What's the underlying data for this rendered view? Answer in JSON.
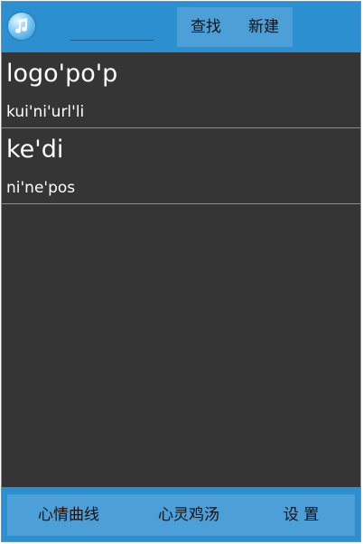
{
  "header": {
    "app_icon": "music-note-icon",
    "search": {
      "value": "",
      "placeholder": ""
    },
    "find_label": "查找",
    "new_label": "新建"
  },
  "list": {
    "items": [
      {
        "title": "logo'po'p",
        "subtitle": "kui'ni'url'li"
      },
      {
        "title": "ke'di",
        "subtitle": "ni'ne'pos"
      }
    ]
  },
  "footer": {
    "mood_curve_label": "心情曲线",
    "soul_soup_label": "心灵鸡汤",
    "settings_label": "设 置"
  },
  "colors": {
    "accent": "#2b8fd0",
    "button_group": "#4c9fd7",
    "background": "#353535"
  }
}
